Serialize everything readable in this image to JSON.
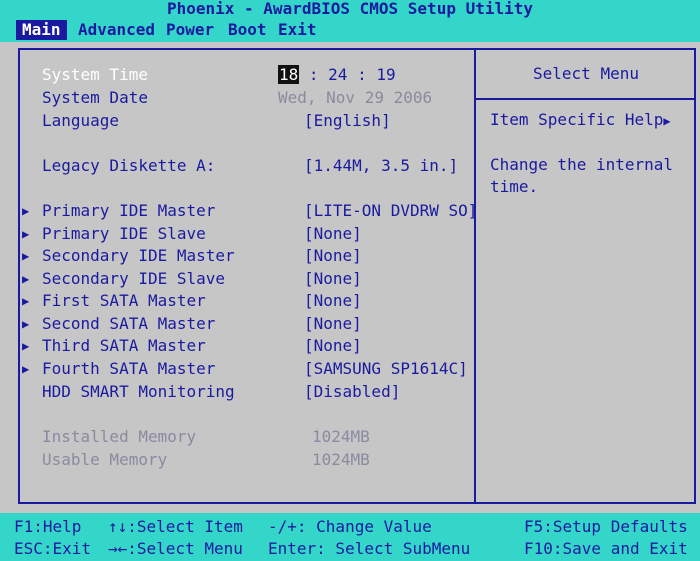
{
  "title": "Phoenix - AwardBIOS CMOS Setup Utility",
  "menu": [
    "Main",
    "Advanced",
    "Power",
    "Boot",
    "Exit"
  ],
  "main": {
    "system_time": {
      "label": "System Time",
      "hour": "18",
      "rest": " : 24 : 19"
    },
    "system_date": {
      "label": "System Date",
      "value": "Wed, Nov 29 2006"
    },
    "language": {
      "label": "Language",
      "value": "[English]"
    },
    "legacy_diskette": {
      "label": "Legacy Diskette A:",
      "value": "[1.44M, 3.5 in.]"
    },
    "drives": [
      {
        "label": "Primary IDE Master",
        "value": "[LITE-ON DVDRW SO]"
      },
      {
        "label": "Primary IDE Slave",
        "value": "[None]"
      },
      {
        "label": "Secondary IDE Master",
        "value": "[None]"
      },
      {
        "label": "Secondary IDE Slave",
        "value": "[None]"
      },
      {
        "label": "First SATA Master",
        "value": "[None]"
      },
      {
        "label": "Second SATA Master",
        "value": "[None]"
      },
      {
        "label": "Third SATA Master",
        "value": "[None]"
      },
      {
        "label": "Fourth SATA Master",
        "value": "[SAMSUNG SP1614C]"
      }
    ],
    "hdd_smart": {
      "label": "HDD SMART Monitoring",
      "value": "[Disabled]"
    },
    "installed_memory": {
      "label": "Installed Memory",
      "value": "1024MB"
    },
    "usable_memory": {
      "label": "Usable Memory",
      "value": "1024MB"
    }
  },
  "help": {
    "title": "Select Menu",
    "subtitle": "Item Specific Help",
    "text": "Change the internal time."
  },
  "footer": {
    "f1": "F1:Help",
    "esc": "ESC:Exit",
    "select_item": "↑↓:Select Item",
    "select_menu": "→←:Select Menu",
    "change_value": "-/+: Change Value",
    "enter": "Enter: Select SubMenu",
    "f5": "F5:Setup Defaults",
    "f10": "F10:Save and Exit"
  },
  "colors": {
    "accent": "#33d6c8",
    "text": "#1a1aa0",
    "background": "#c6c6c6"
  }
}
